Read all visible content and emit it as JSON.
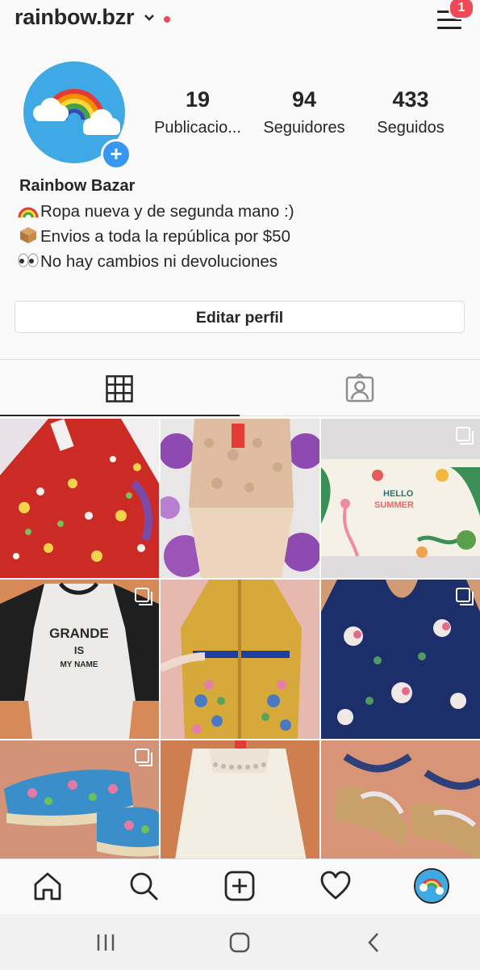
{
  "header": {
    "username": "rainbow.bzr",
    "notification_count": "1"
  },
  "stats": [
    {
      "value": "19",
      "label": "Publicacio..."
    },
    {
      "value": "94",
      "label": "Seguidores"
    },
    {
      "value": "433",
      "label": "Seguidos"
    }
  ],
  "bio": {
    "name": "Rainbow Bazar",
    "lines": [
      "Ropa nueva y de segunda mano :)",
      "Envios a toda la república por $50",
      "No hay cambios ni devoluciones"
    ]
  },
  "edit_profile_label": "Editar perfil",
  "posts": {
    "tile_3_text_1": "HELLO",
    "tile_3_text_2": "SUMMER",
    "tile_4_text_1": "GRANDE",
    "tile_4_text_2": "IS",
    "tile_4_text_3": "MY NAME"
  }
}
